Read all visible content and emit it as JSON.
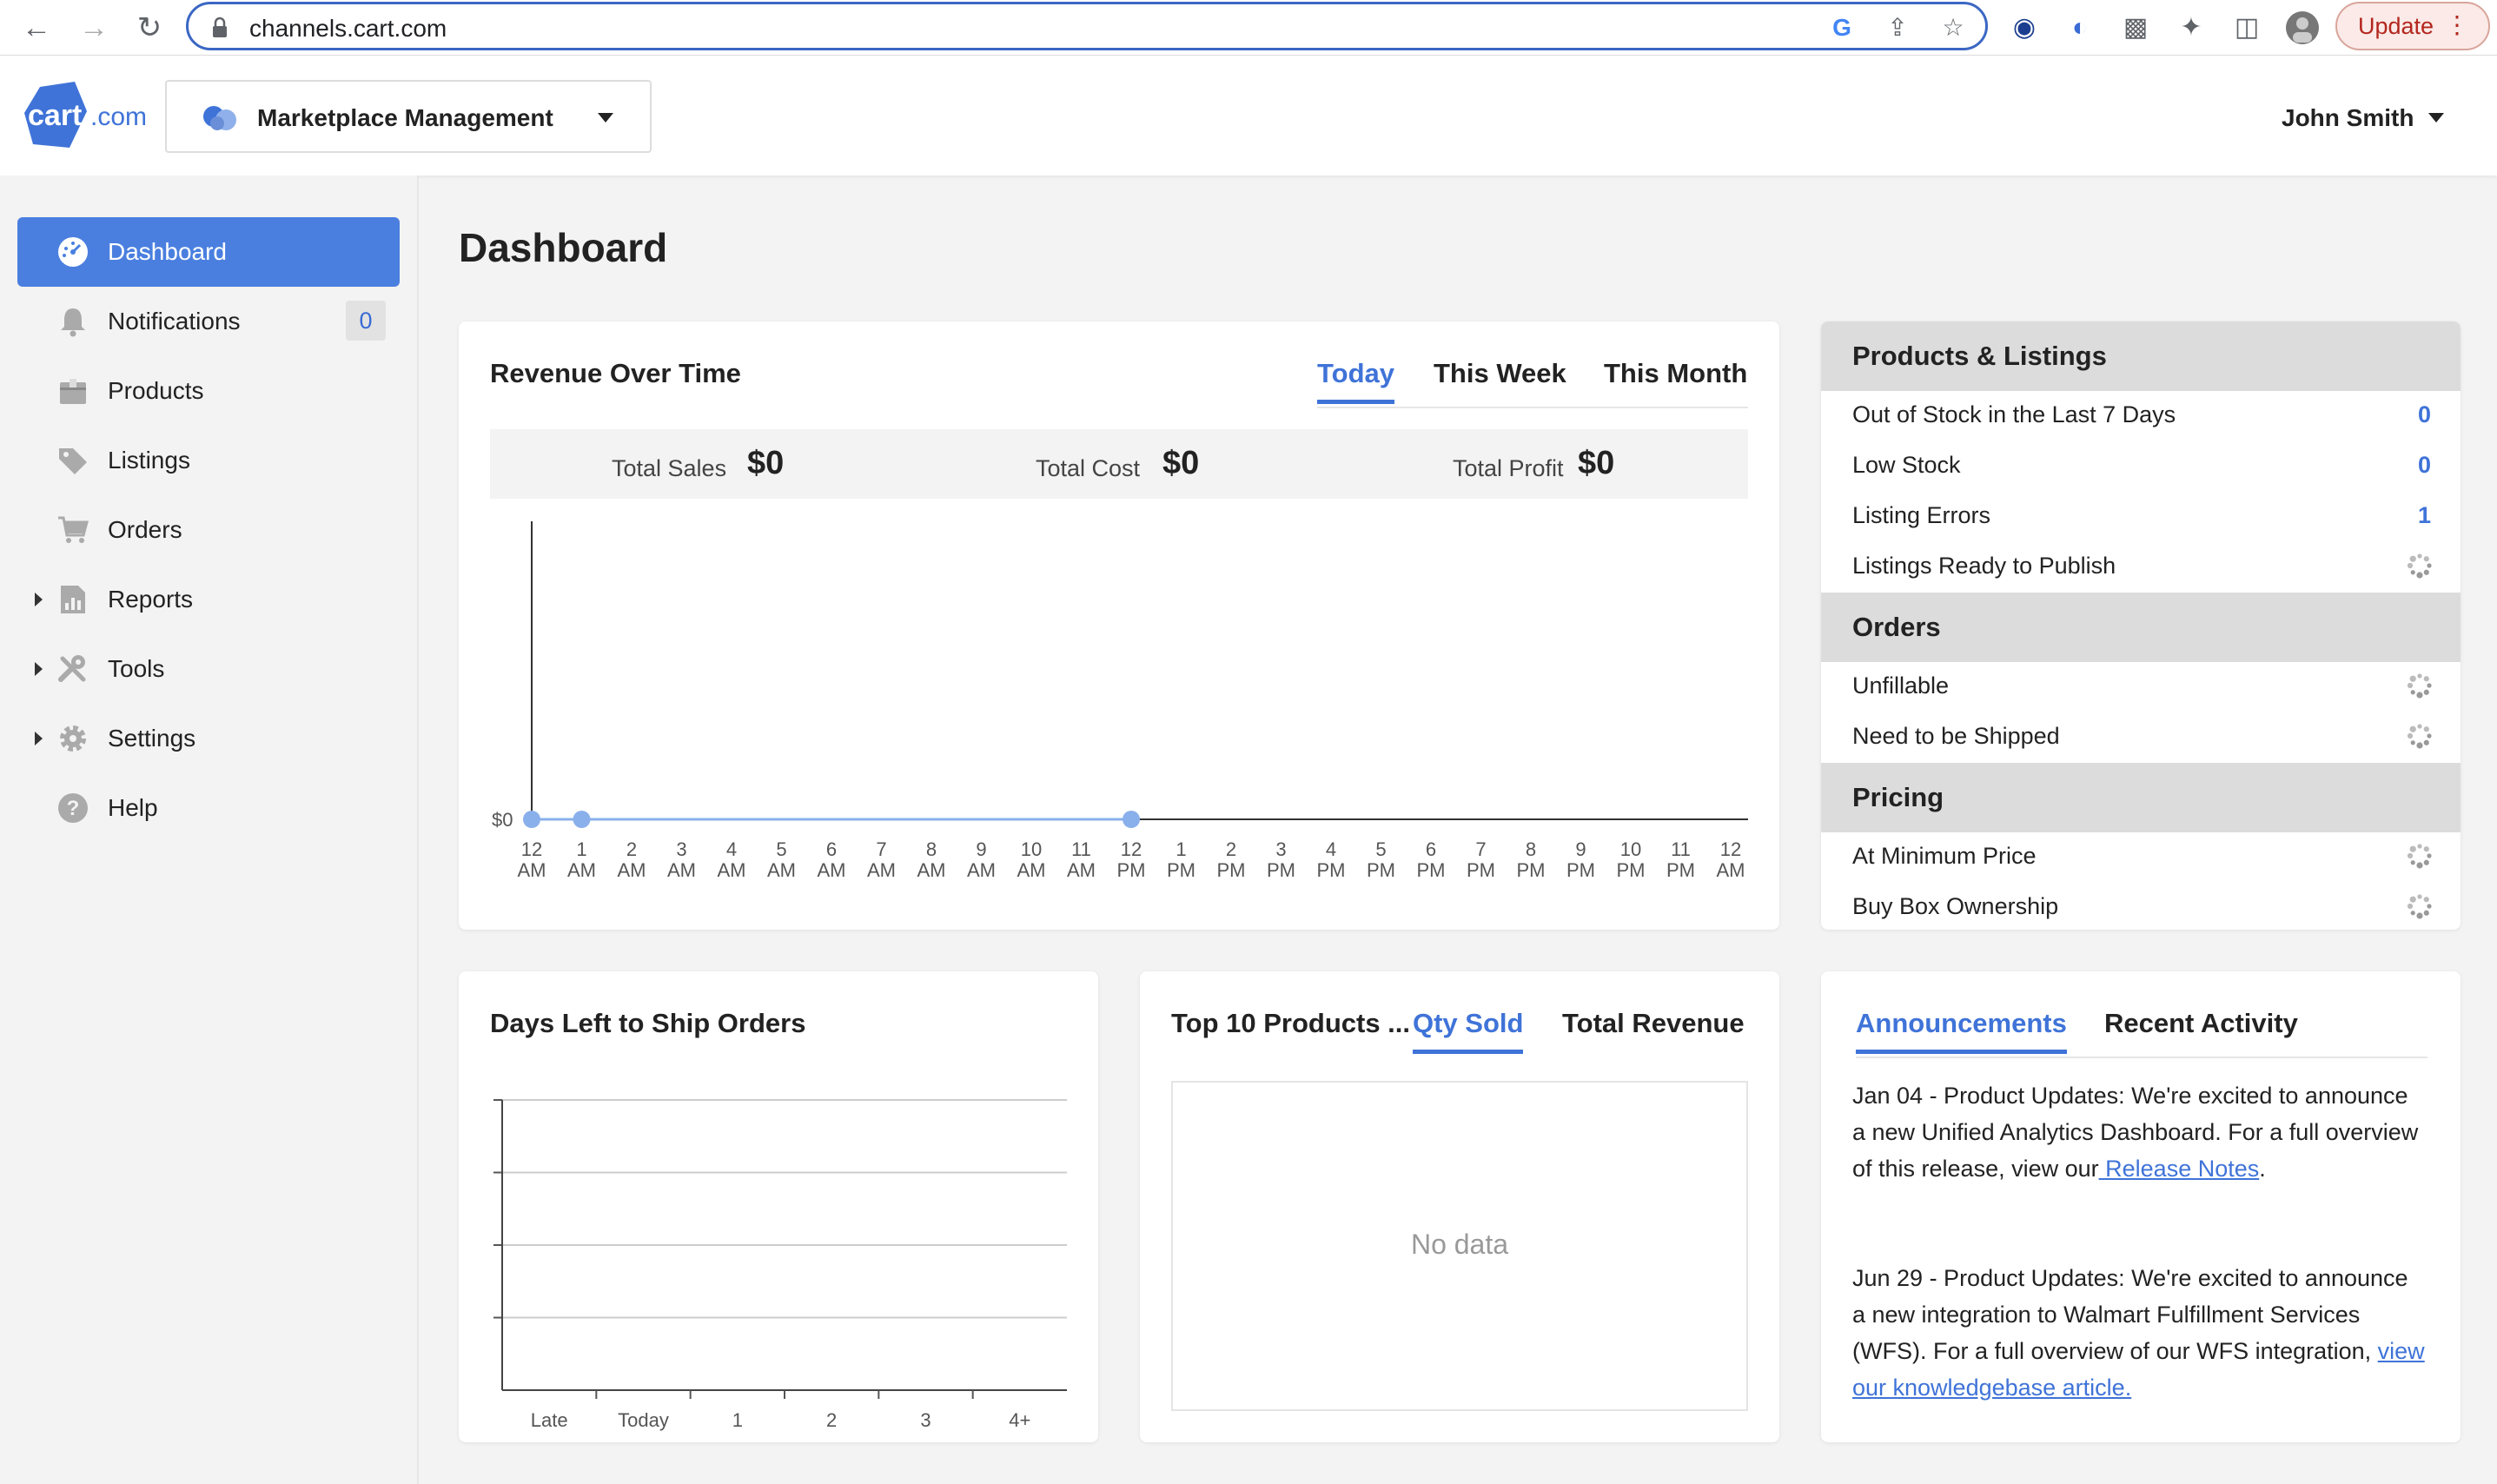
{
  "browser": {
    "url": "channels.cart.com",
    "update_label": "Update"
  },
  "header": {
    "logo_text": "cart.com",
    "marketplace_select": "Marketplace Management",
    "user_name": "John Smith"
  },
  "sidebar": {
    "items": [
      {
        "label": "Dashboard",
        "icon": "dashboard-icon",
        "active": true
      },
      {
        "label": "Notifications",
        "icon": "bell-icon",
        "badge": "0"
      },
      {
        "label": "Products",
        "icon": "box-icon"
      },
      {
        "label": "Listings",
        "icon": "tag-icon"
      },
      {
        "label": "Orders",
        "icon": "cart-icon"
      },
      {
        "label": "Reports",
        "icon": "report-icon",
        "expandable": true
      },
      {
        "label": "Tools",
        "icon": "tools-icon",
        "expandable": true
      },
      {
        "label": "Settings",
        "icon": "gear-icon",
        "expandable": true
      },
      {
        "label": "Help",
        "icon": "help-icon"
      }
    ]
  },
  "main": {
    "title": "Dashboard",
    "revenue": {
      "title": "Revenue Over Time",
      "tabs": [
        "Today",
        "This Week",
        "This Month"
      ],
      "active_tab": "Today",
      "total_sales_label": "Total Sales",
      "total_sales_value": "$0",
      "total_cost_label": "Total Cost",
      "total_cost_value": "$0",
      "total_profit_label": "Total Profit",
      "total_profit_value": "$0"
    },
    "days_left": {
      "title": "Days Left to Ship Orders"
    },
    "top_products": {
      "title": "Top 10 Products ...",
      "tabs": [
        "Qty Sold",
        "Total Revenue"
      ],
      "active_tab": "Qty Sold",
      "empty_text": "No data"
    },
    "panel": {
      "sections": [
        {
          "title": "Products & Listings",
          "rows": [
            {
              "label": "Out of Stock in the Last 7 Days",
              "value": "0"
            },
            {
              "label": "Low Stock",
              "value": "0"
            },
            {
              "label": "Listing Errors",
              "value": "1"
            },
            {
              "label": "Listings Ready to Publish",
              "loading": true
            }
          ]
        },
        {
          "title": "Orders",
          "rows": [
            {
              "label": "Unfillable",
              "loading": true
            },
            {
              "label": "Need to be Shipped",
              "loading": true
            }
          ]
        },
        {
          "title": "Pricing",
          "rows": [
            {
              "label": "At Minimum Price",
              "loading": true
            },
            {
              "label": "Buy Box Ownership",
              "loading": true
            }
          ]
        }
      ]
    },
    "announcements": {
      "tabs": [
        "Announcements",
        "Recent Activity"
      ],
      "active_tab": "Announcements",
      "items": [
        {
          "text": "Jan 04 - Product Updates: We're excited to announce a new Unified Analytics Dashboard. For a full overview of this release, view our",
          "link": " Release Notes",
          "tail": "."
        },
        {
          "text": "Jun 29 - Product Updates: We're excited to announce a new integration to Walmart Fulfillment Services (WFS). For a full overview of our WFS integration, ",
          "link": "view our knowledgebase article. ",
          "tail": ""
        }
      ]
    }
  },
  "chart_data": [
    {
      "type": "line",
      "title": "Revenue Over Time",
      "categories": [
        "12 AM",
        "1 AM",
        "2 AM",
        "3 AM",
        "4 AM",
        "5 AM",
        "6 AM",
        "7 AM",
        "8 AM",
        "9 AM",
        "10 AM",
        "11 AM",
        "12 PM",
        "1 PM",
        "2 PM",
        "3 PM",
        "4 PM",
        "5 PM",
        "6 PM",
        "7 PM",
        "8 PM",
        "9 PM",
        "10 PM",
        "11 PM",
        "12 AM"
      ],
      "series": [
        {
          "values": [
            0,
            0,
            0,
            null,
            null,
            null,
            null,
            null,
            null,
            null,
            null,
            null,
            0,
            null,
            null,
            null,
            null,
            null,
            null,
            null,
            null,
            null,
            null,
            null,
            null
          ],
          "markers": [
            0,
            1,
            12
          ]
        }
      ],
      "y_tick_labels": [
        "$0"
      ],
      "color": "#8ab0ec"
    },
    {
      "type": "bar",
      "title": "Days Left to Ship Orders",
      "categories": [
        "Late",
        "Today",
        "1",
        "2",
        "3",
        "4+"
      ],
      "values": [
        0,
        0,
        0,
        0,
        0,
        0
      ],
      "grid": true
    }
  ]
}
